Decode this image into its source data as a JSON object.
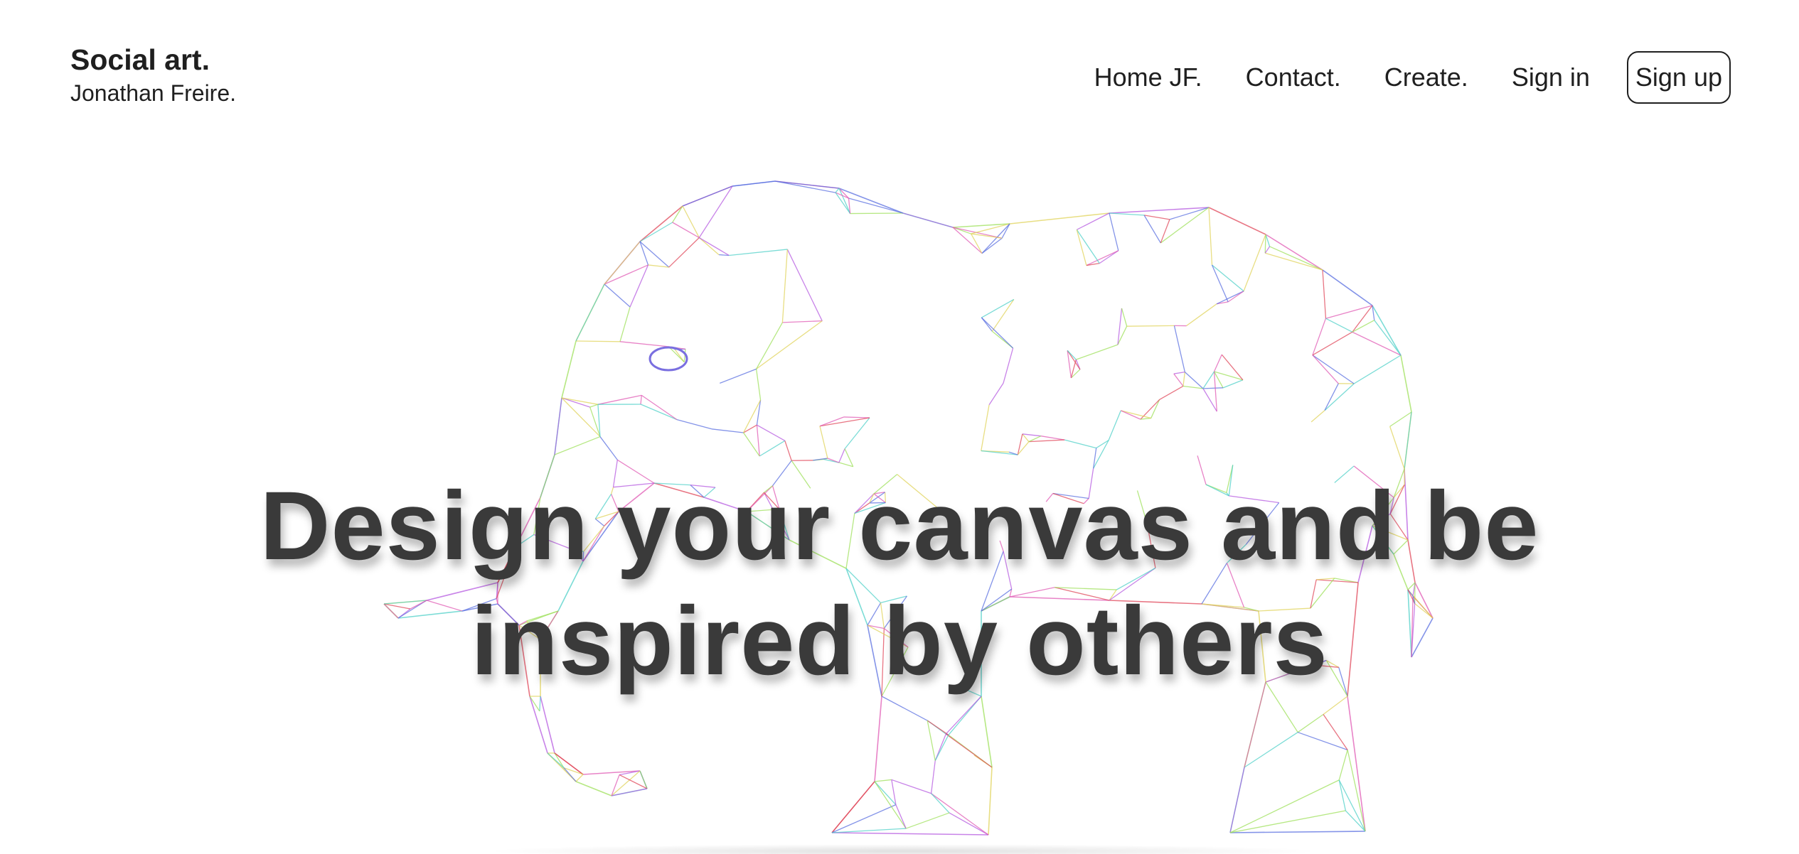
{
  "brand": {
    "title": "Social art.",
    "subtitle": "Jonathan Freire."
  },
  "nav": {
    "links": [
      "Home JF.",
      "Contact.",
      "Create.",
      "Sign in"
    ],
    "signup": "Sign up"
  },
  "hero": {
    "headline": "Design your canvas and be inspired by others",
    "illustration": "elephant-wireframe-illustration"
  },
  "colors": {
    "text": "#1f1f1f",
    "headline": "#3a3a3a",
    "background": "#ffffff",
    "wire_palette": [
      "#e05ab4",
      "#5a6fe0",
      "#4fd0c8",
      "#9ee05a",
      "#e0d35a",
      "#b65ae0",
      "#e0475a"
    ]
  }
}
